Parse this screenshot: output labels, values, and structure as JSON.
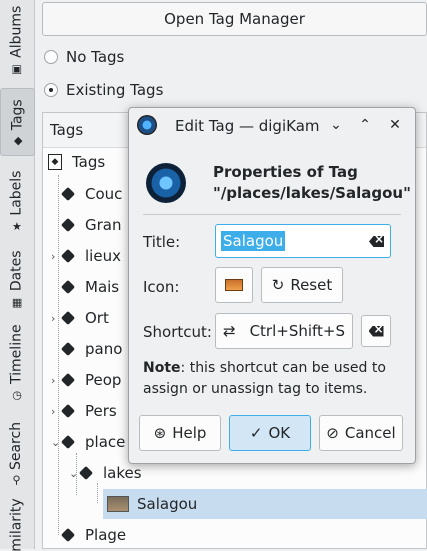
{
  "sidebar_tabs": [
    {
      "label": "Albums",
      "icon": "album-icon"
    },
    {
      "label": "Tags",
      "icon": "tag-icon",
      "active": true
    },
    {
      "label": "Labels",
      "icon": "star-icon"
    },
    {
      "label": "Dates",
      "icon": "calendar-icon"
    },
    {
      "label": "Timeline",
      "icon": "timeline-icon"
    },
    {
      "label": "Search",
      "icon": "search-icon"
    },
    {
      "label": "milarity",
      "icon": ""
    }
  ],
  "panel": {
    "open_tag_manager": "Open Tag Manager",
    "radio_no_tags": "No Tags",
    "radio_existing_tags": "Existing Tags",
    "tree_header": "Tags",
    "tree_items": [
      {
        "label": "Tags",
        "level": 0
      },
      {
        "label": "Couc",
        "level": 1
      },
      {
        "label": "Gran",
        "level": 1
      },
      {
        "label": "lieux",
        "level": 1,
        "expandable": true
      },
      {
        "label": "Mais",
        "level": 1
      },
      {
        "label": "Ort",
        "level": 1,
        "expandable": true
      },
      {
        "label": "pano",
        "level": 1
      },
      {
        "label": "Peop",
        "level": 1,
        "expandable": true
      },
      {
        "label": "Pers",
        "level": 1,
        "expandable": true
      },
      {
        "label": "place",
        "level": 1,
        "expanded": true
      },
      {
        "label": "lakes",
        "level": 2,
        "expanded": true
      },
      {
        "label": "Salagou",
        "level": 3,
        "selected": true
      },
      {
        "label": "Plage",
        "level": 1
      }
    ]
  },
  "dialog": {
    "title": "Edit Tag — digiKam",
    "heading_line1": "Properties of Tag",
    "heading_line2": "\"/places/lakes/Salagou\"",
    "title_label": "Title:",
    "title_value": "Salagou",
    "icon_label": "Icon:",
    "reset_label": "Reset",
    "shortcut_label": "Shortcut:",
    "shortcut_value": "Ctrl+Shift+S",
    "note_bold": "Note",
    "note_rest": ": this shortcut can be used to assign or unassign tag to items.",
    "help_label": "Help",
    "ok_label": "OK",
    "cancel_label": "Cancel"
  },
  "colors": {
    "accent": "#3daee9",
    "selection": "#c8dcef"
  }
}
